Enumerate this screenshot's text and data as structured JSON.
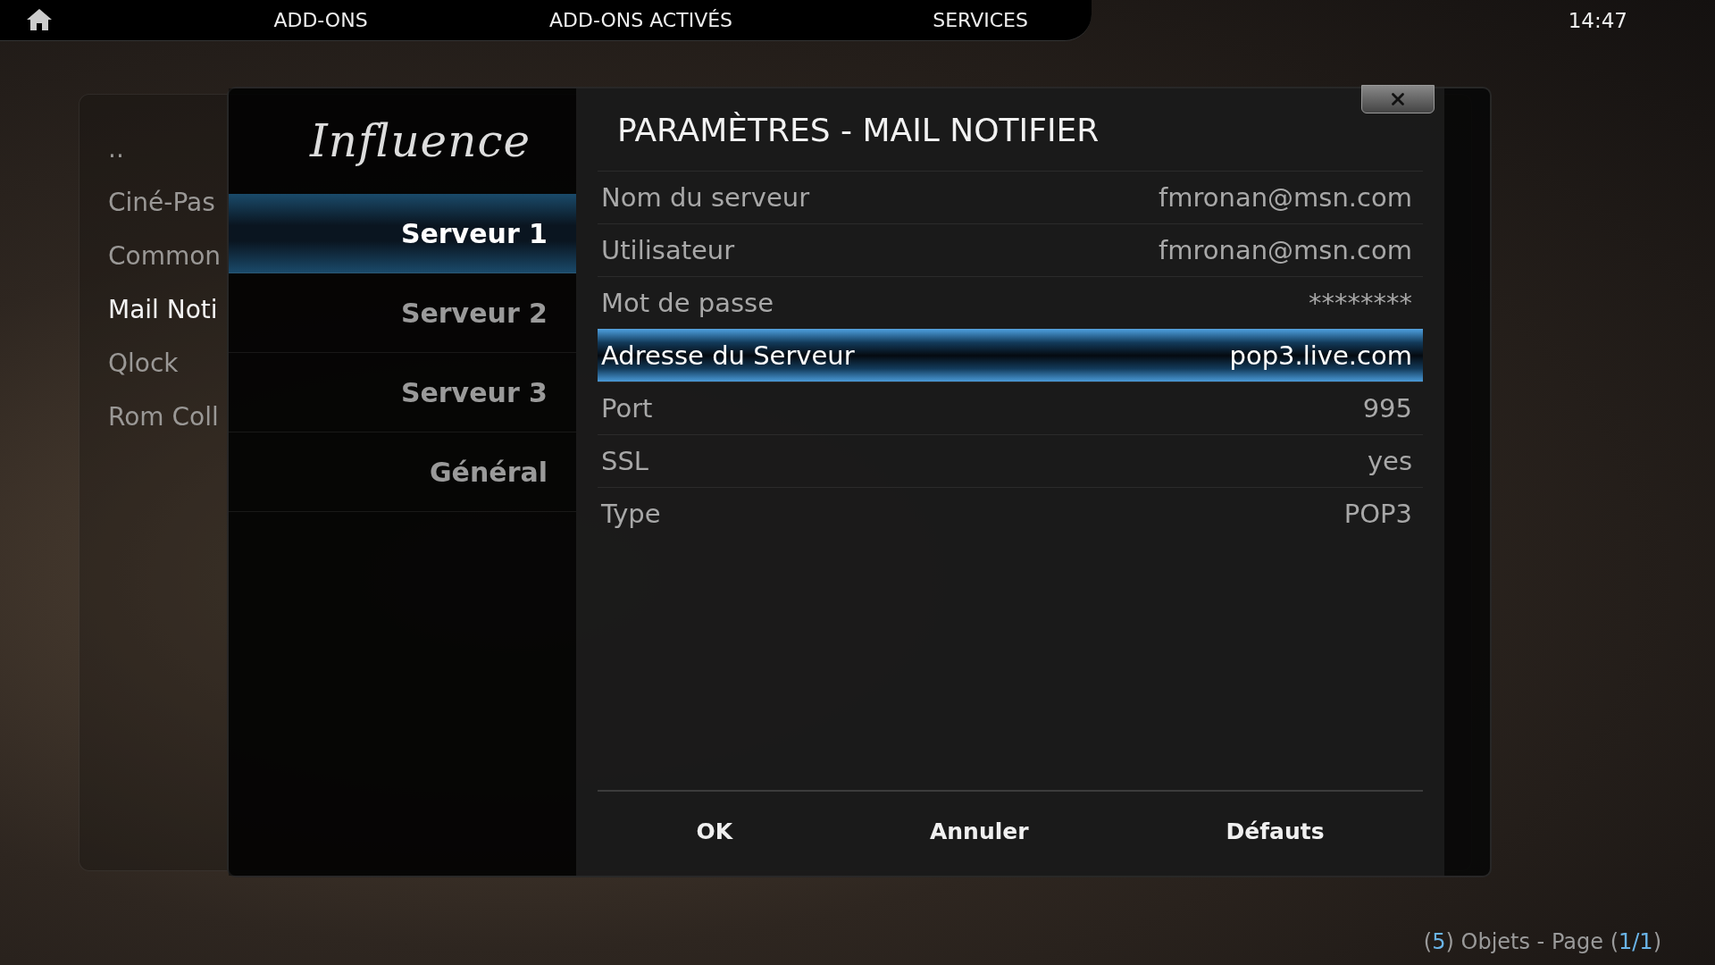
{
  "top_bar": {
    "tabs": [
      {
        "label": "ADD-ONS"
      },
      {
        "label": "ADD-ONS ACTIVÉS"
      },
      {
        "label": "SERVICES"
      }
    ],
    "clock": "14:47"
  },
  "addon_list": {
    "items": [
      {
        "name": "..",
        "selected": false
      },
      {
        "name": "Ciné-Pas",
        "selected": false
      },
      {
        "name": "Common",
        "selected": false
      },
      {
        "name": "Mail Noti",
        "selected": true
      },
      {
        "name": "Qlock",
        "selected": false
      },
      {
        "name": "Rom Coll",
        "selected": false
      }
    ]
  },
  "dialog": {
    "logo": "Influence",
    "title": "PARAMÈTRES - MAIL NOTIFIER",
    "categories": [
      {
        "label": "Serveur 1",
        "selected": true
      },
      {
        "label": "Serveur 2",
        "selected": false
      },
      {
        "label": "Serveur 3",
        "selected": false
      },
      {
        "label": "Général",
        "selected": false
      }
    ],
    "settings": [
      {
        "label": "Nom du serveur",
        "value": "fmronan@msn.com",
        "selected": false
      },
      {
        "label": "Utilisateur",
        "value": "fmronan@msn.com",
        "selected": false
      },
      {
        "label": "Mot de passe",
        "value": "********",
        "selected": false
      },
      {
        "label": "Adresse du Serveur",
        "value": "pop3.live.com",
        "selected": true
      },
      {
        "label": "Port",
        "value": "995",
        "selected": false
      },
      {
        "label": "SSL",
        "value": "yes",
        "selected": false
      },
      {
        "label": "Type",
        "value": "POP3",
        "selected": false
      }
    ],
    "buttons": [
      "OK",
      "Annuler",
      "Défauts"
    ]
  },
  "footer": {
    "segments": [
      {
        "text": "(",
        "accent": false
      },
      {
        "text": "5",
        "accent": true
      },
      {
        "text": ") Objets - Page (",
        "accent": false
      },
      {
        "text": "1/1",
        "accent": true
      },
      {
        "text": ")",
        "accent": false
      }
    ]
  }
}
